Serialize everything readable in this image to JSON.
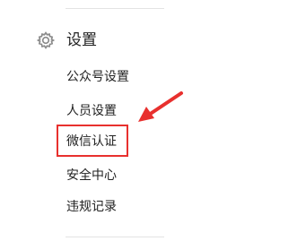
{
  "section": {
    "title": "设置",
    "icon": "gear-icon"
  },
  "menu": {
    "items": [
      {
        "label": "公众号设置"
      },
      {
        "label": "人员设置"
      },
      {
        "label": "微信认证",
        "highlighted": true
      },
      {
        "label": "安全中心"
      },
      {
        "label": "违规记录"
      }
    ]
  },
  "annotation": {
    "color": "#e8302e",
    "arrow_icon": "arrow-pointer-icon"
  }
}
